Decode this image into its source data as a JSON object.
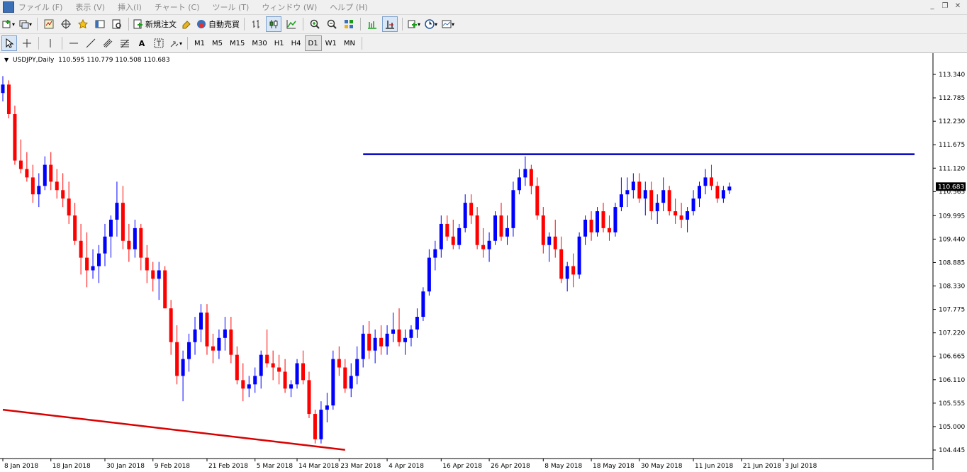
{
  "menu": [
    "ファイル (F)",
    "表示 (V)",
    "挿入(I)",
    "チャート (C)",
    "ツール (T)",
    "ウィンドウ (W)",
    "ヘルプ (H)"
  ],
  "toolbar": {
    "new_order_label": "新規注文",
    "auto_trade_label": "自動売買"
  },
  "timeframes": [
    "M1",
    "M5",
    "M15",
    "M30",
    "H1",
    "H4",
    "D1",
    "W1",
    "MN"
  ],
  "active_timeframe": "D1",
  "chart": {
    "symbol_line": "USDJPY,Daily",
    "ohlc": "110.595 110.779 110.508 110.683",
    "current_price": "110.683"
  },
  "chart_data": {
    "type": "candlestick",
    "y_ticks": [
      "113.340",
      "112.785",
      "112.230",
      "111.675",
      "111.120",
      "110.565",
      "109.995",
      "109.440",
      "108.885",
      "108.330",
      "107.775",
      "107.220",
      "106.665",
      "106.110",
      "105.555",
      "105.000",
      "104.445"
    ],
    "ylim": [
      104.445,
      113.34
    ],
    "x_labels": [
      "8 Jan 2018",
      "18 Jan 2018",
      "30 Jan 2018",
      "9 Feb 2018",
      "21 Feb 2018",
      "5 Mar 2018",
      "14 Mar 2018",
      "23 Mar 2018",
      "4 Apr 2018",
      "16 Apr 2018",
      "26 Apr 2018",
      "8 May 2018",
      "18 May 2018",
      "30 May 2018",
      "11 Jun 2018",
      "21 Jun 2018",
      "3 Jul 2018"
    ],
    "up_color": "#0000ff",
    "down_color": "#ff0000",
    "candles": [
      [
        112.9,
        113.3,
        112.7,
        113.1
      ],
      [
        113.1,
        113.2,
        112.3,
        112.4
      ],
      [
        112.4,
        112.6,
        111.2,
        111.3
      ],
      [
        111.3,
        111.8,
        111.0,
        111.1
      ],
      [
        111.1,
        111.5,
        110.8,
        110.9
      ],
      [
        110.9,
        111.2,
        110.3,
        110.5
      ],
      [
        110.5,
        111.0,
        110.2,
        110.7
      ],
      [
        110.7,
        111.4,
        110.6,
        111.2
      ],
      [
        111.2,
        111.5,
        110.6,
        110.8
      ],
      [
        110.8,
        111.1,
        110.4,
        110.6
      ],
      [
        110.6,
        111.0,
        110.2,
        110.4
      ],
      [
        110.4,
        110.8,
        109.8,
        110.0
      ],
      [
        110.0,
        110.3,
        109.3,
        109.4
      ],
      [
        109.4,
        109.8,
        108.6,
        109.0
      ],
      [
        109.0,
        109.6,
        108.3,
        108.7
      ],
      [
        108.7,
        109.2,
        108.5,
        108.8
      ],
      [
        108.8,
        109.3,
        108.4,
        109.1
      ],
      [
        109.1,
        109.8,
        108.8,
        109.5
      ],
      [
        109.5,
        110.0,
        109.0,
        109.9
      ],
      [
        109.9,
        110.8,
        109.5,
        110.3
      ],
      [
        110.3,
        110.7,
        109.2,
        109.4
      ],
      [
        109.4,
        109.8,
        108.9,
        109.2
      ],
      [
        109.2,
        109.9,
        109.0,
        109.7
      ],
      [
        109.7,
        109.8,
        108.7,
        109.0
      ],
      [
        109.0,
        109.3,
        108.4,
        108.7
      ],
      [
        108.7,
        108.9,
        108.2,
        108.5
      ],
      [
        108.5,
        108.9,
        108.0,
        108.7
      ],
      [
        108.7,
        108.8,
        107.8,
        107.8
      ],
      [
        107.8,
        108.0,
        106.7,
        107.0
      ],
      [
        107.0,
        107.4,
        106.0,
        106.2
      ],
      [
        106.2,
        106.8,
        105.6,
        106.6
      ],
      [
        106.6,
        107.2,
        106.3,
        107.0
      ],
      [
        107.0,
        107.6,
        106.7,
        107.3
      ],
      [
        107.3,
        107.9,
        107.0,
        107.7
      ],
      [
        107.7,
        107.9,
        106.7,
        106.9
      ],
      [
        106.9,
        107.2,
        106.5,
        106.8
      ],
      [
        106.8,
        107.3,
        106.6,
        107.1
      ],
      [
        107.1,
        107.6,
        106.8,
        107.3
      ],
      [
        107.3,
        107.6,
        106.5,
        106.7
      ],
      [
        106.7,
        106.9,
        106.0,
        106.1
      ],
      [
        106.1,
        106.5,
        105.6,
        105.9
      ],
      [
        105.9,
        106.2,
        105.7,
        106.0
      ],
      [
        106.0,
        106.4,
        105.8,
        106.2
      ],
      [
        106.2,
        106.8,
        105.9,
        106.7
      ],
      [
        106.7,
        107.3,
        106.4,
        106.5
      ],
      [
        106.5,
        106.8,
        106.1,
        106.4
      ],
      [
        106.4,
        106.7,
        106.0,
        106.3
      ],
      [
        106.3,
        106.6,
        105.8,
        105.9
      ],
      [
        105.9,
        106.1,
        105.7,
        106.0
      ],
      [
        106.0,
        106.6,
        105.9,
        106.5
      ],
      [
        106.5,
        106.8,
        106.0,
        106.1
      ],
      [
        106.1,
        106.3,
        105.2,
        105.3
      ],
      [
        105.3,
        105.4,
        104.6,
        104.7
      ],
      [
        104.7,
        105.6,
        104.6,
        105.4
      ],
      [
        105.4,
        105.8,
        105.1,
        105.5
      ],
      [
        105.5,
        106.8,
        105.4,
        106.6
      ],
      [
        106.6,
        106.9,
        106.2,
        106.4
      ],
      [
        106.4,
        106.6,
        105.8,
        105.9
      ],
      [
        105.9,
        106.5,
        105.7,
        106.2
      ],
      [
        106.2,
        106.9,
        106.0,
        106.6
      ],
      [
        106.6,
        107.4,
        106.4,
        107.2
      ],
      [
        107.2,
        107.5,
        106.6,
        106.8
      ],
      [
        106.8,
        107.3,
        106.5,
        107.1
      ],
      [
        107.1,
        107.4,
        106.7,
        106.9
      ],
      [
        106.9,
        107.4,
        106.7,
        107.2
      ],
      [
        107.2,
        107.7,
        107.0,
        107.3
      ],
      [
        107.3,
        107.8,
        106.9,
        107.0
      ],
      [
        107.0,
        107.3,
        106.7,
        107.1
      ],
      [
        107.1,
        107.4,
        106.9,
        107.3
      ],
      [
        107.3,
        107.8,
        107.1,
        107.6
      ],
      [
        107.6,
        108.3,
        107.5,
        108.2
      ],
      [
        108.2,
        109.2,
        108.1,
        109.0
      ],
      [
        109.0,
        109.4,
        108.7,
        109.2
      ],
      [
        109.2,
        110.0,
        109.0,
        109.8
      ],
      [
        109.8,
        110.0,
        109.4,
        109.5
      ],
      [
        109.5,
        109.9,
        109.2,
        109.3
      ],
      [
        109.3,
        109.8,
        109.2,
        109.7
      ],
      [
        109.7,
        110.5,
        109.6,
        110.3
      ],
      [
        110.3,
        110.5,
        109.8,
        110.0
      ],
      [
        110.0,
        110.2,
        109.2,
        109.3
      ],
      [
        109.3,
        109.7,
        109.0,
        109.2
      ],
      [
        109.2,
        109.6,
        108.9,
        109.4
      ],
      [
        109.4,
        110.1,
        109.3,
        110.0
      ],
      [
        110.0,
        110.3,
        109.4,
        109.5
      ],
      [
        109.5,
        110.0,
        109.3,
        109.7
      ],
      [
        109.7,
        110.8,
        109.5,
        110.6
      ],
      [
        110.6,
        111.1,
        110.5,
        110.9
      ],
      [
        110.9,
        111.4,
        110.7,
        111.1
      ],
      [
        111.1,
        111.2,
        110.5,
        110.7
      ],
      [
        110.7,
        110.9,
        109.9,
        110.0
      ],
      [
        110.0,
        110.2,
        109.1,
        109.3
      ],
      [
        109.3,
        109.6,
        108.9,
        109.5
      ],
      [
        109.5,
        109.9,
        109.0,
        109.2
      ],
      [
        109.2,
        109.5,
        108.4,
        108.5
      ],
      [
        108.5,
        108.9,
        108.2,
        108.8
      ],
      [
        108.8,
        109.1,
        108.3,
        108.6
      ],
      [
        108.6,
        109.6,
        108.5,
        109.5
      ],
      [
        109.5,
        110.0,
        109.3,
        109.9
      ],
      [
        109.9,
        110.1,
        109.4,
        109.6
      ],
      [
        109.6,
        110.2,
        109.5,
        110.1
      ],
      [
        110.1,
        110.3,
        109.6,
        109.7
      ],
      [
        109.7,
        110.0,
        109.4,
        109.6
      ],
      [
        109.6,
        110.3,
        109.5,
        110.2
      ],
      [
        110.2,
        110.9,
        110.1,
        110.5
      ],
      [
        110.5,
        110.9,
        110.2,
        110.6
      ],
      [
        110.6,
        111.0,
        110.4,
        110.8
      ],
      [
        110.8,
        111.0,
        110.3,
        110.4
      ],
      [
        110.4,
        110.8,
        110.0,
        110.6
      ],
      [
        110.6,
        110.8,
        109.9,
        110.1
      ],
      [
        110.1,
        110.5,
        109.8,
        110.3
      ],
      [
        110.3,
        110.9,
        110.1,
        110.6
      ],
      [
        110.6,
        110.7,
        110.0,
        110.1
      ],
      [
        110.1,
        110.4,
        109.8,
        110.0
      ],
      [
        110.0,
        110.3,
        109.7,
        109.9
      ],
      [
        109.9,
        110.2,
        109.6,
        110.1
      ],
      [
        110.1,
        110.6,
        110.0,
        110.4
      ],
      [
        110.4,
        110.8,
        110.2,
        110.7
      ],
      [
        110.7,
        111.1,
        110.5,
        110.9
      ],
      [
        110.9,
        111.2,
        110.6,
        110.7
      ],
      [
        110.7,
        110.8,
        110.3,
        110.4
      ],
      [
        110.4,
        110.7,
        110.3,
        110.6
      ],
      [
        110.595,
        110.779,
        110.508,
        110.683
      ]
    ],
    "lines": [
      {
        "color": "#0000bf",
        "from": [
          "4 Apr 2018",
          111.45
        ],
        "to": [
          "extends right",
          111.45
        ]
      },
      {
        "color": "#d90000",
        "from": [
          "8 Jan 2018",
          105.4
        ],
        "to": [
          "23 Mar 2018",
          104.45
        ]
      }
    ]
  }
}
